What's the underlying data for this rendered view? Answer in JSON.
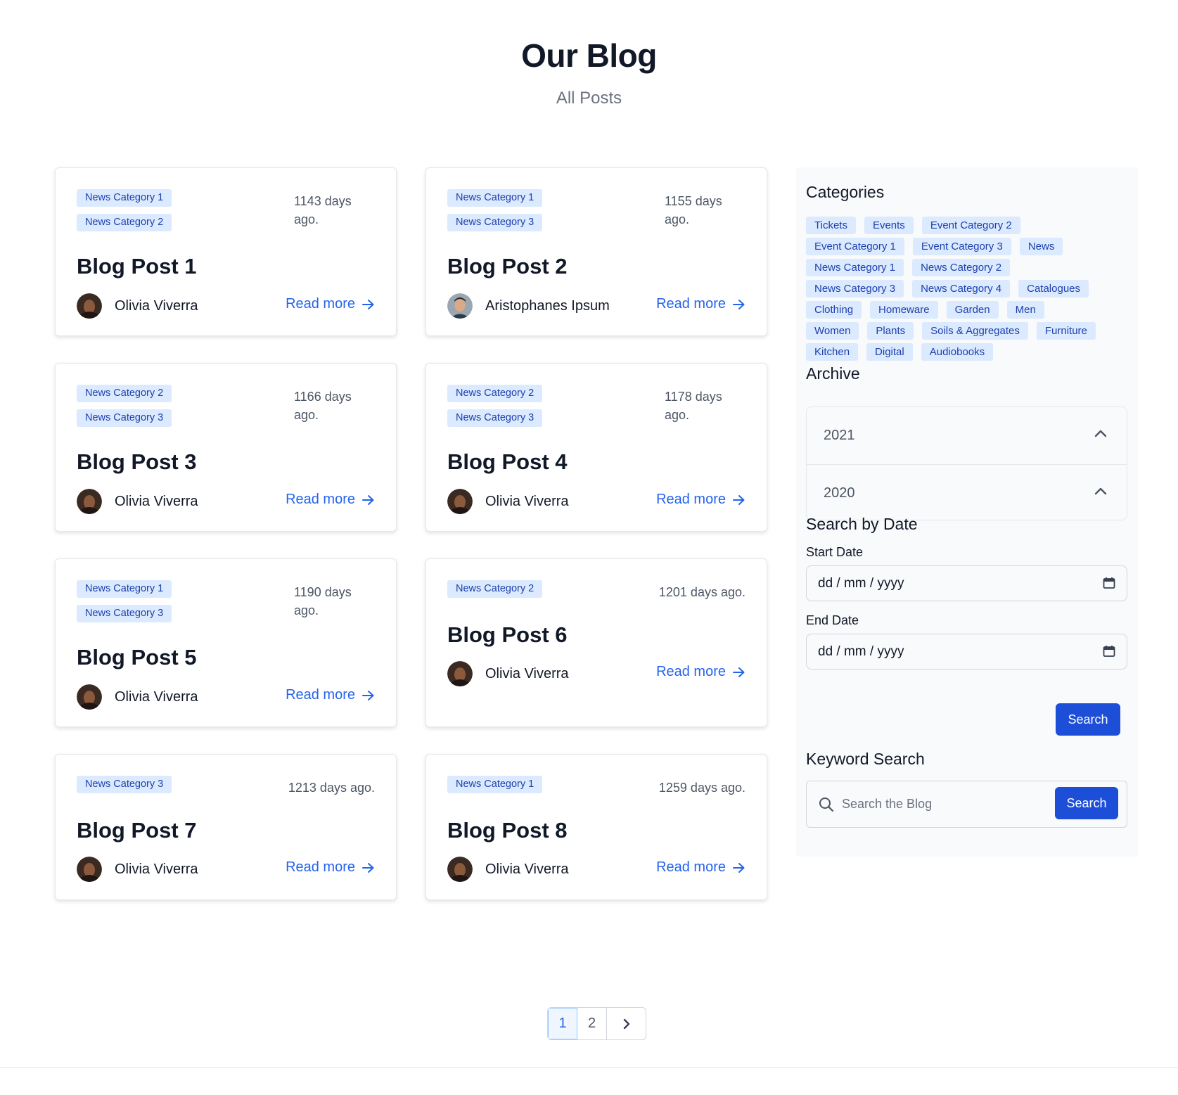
{
  "header": {
    "title": "Our Blog",
    "subtitle": "All Posts"
  },
  "posts": [
    {
      "tags": [
        "News Category 1",
        "News Category 2"
      ],
      "date": "1143 days ago.",
      "title": "Blog Post 1",
      "author": "Olivia Viverra",
      "avatar": "woman",
      "read_more": "Read more"
    },
    {
      "tags": [
        "News Category 1",
        "News Category 3"
      ],
      "date": "1155 days ago.",
      "title": "Blog Post 2",
      "author": "Aristophanes Ipsum",
      "avatar": "man",
      "read_more": "Read more"
    },
    {
      "tags": [
        "News Category 2",
        "News Category 3"
      ],
      "date": "1166 days ago.",
      "title": "Blog Post 3",
      "author": "Olivia Viverra",
      "avatar": "woman",
      "read_more": "Read more"
    },
    {
      "tags": [
        "News Category 2",
        "News Category 3"
      ],
      "date": "1178 days ago.",
      "title": "Blog Post 4",
      "author": "Olivia Viverra",
      "avatar": "woman",
      "read_more": "Read more"
    },
    {
      "tags": [
        "News Category 1",
        "News Category 3"
      ],
      "date": "1190 days ago.",
      "title": "Blog Post 5",
      "author": "Olivia Viverra",
      "avatar": "woman",
      "read_more": "Read more"
    },
    {
      "tags": [
        "News Category 2"
      ],
      "date": "1201 days ago.",
      "title": "Blog Post 6",
      "author": "Olivia Viverra",
      "avatar": "woman",
      "read_more": "Read more"
    },
    {
      "tags": [
        "News Category 3"
      ],
      "date": "1213 days ago.",
      "title": "Blog Post 7",
      "author": "Olivia Viverra",
      "avatar": "woman",
      "read_more": "Read more"
    },
    {
      "tags": [
        "News Category 1"
      ],
      "date": "1259 days ago.",
      "title": "Blog Post 8",
      "author": "Olivia Viverra",
      "avatar": "woman",
      "read_more": "Read more"
    }
  ],
  "sidebar": {
    "categories_heading": "Categories",
    "categories": [
      [
        "Tickets",
        "Events",
        "Event Category 2"
      ],
      [
        "Event Category 1",
        "Event Category 3",
        "News"
      ],
      [
        "News Category 1",
        "News Category 2"
      ],
      [
        "News Category 3",
        "News Category 4",
        "Catalogues"
      ],
      [
        "Clothing",
        "Homeware",
        "Garden",
        "Men"
      ],
      [
        "Women",
        "Plants",
        "Soils & Aggregates",
        "Furniture"
      ],
      [
        "Kitchen",
        "Digital",
        "Audiobooks"
      ]
    ],
    "archive_heading": "Archive",
    "archive_years": [
      "2021",
      "2020"
    ],
    "date_search": {
      "heading": "Search by Date",
      "start_label": "Start Date",
      "start_placeholder": "dd / mm / yyyy",
      "end_label": "End Date",
      "end_placeholder": "dd / mm / yyyy",
      "button": "Search"
    },
    "keyword_search": {
      "heading": "Keyword Search",
      "placeholder": "Search the Blog",
      "button": "Search"
    }
  },
  "pagination": {
    "pages": [
      "1",
      "2"
    ],
    "current": "1"
  },
  "colors": {
    "accent": "#2563eb",
    "button": "#1d4ed8",
    "tag_bg": "#dbeafe",
    "tag_text": "#1e40af"
  },
  "icons": {
    "read_more": "arrow-right-icon",
    "archive_toggle": "chevron-up-icon",
    "date_picker": "calendar-icon",
    "search": "search-icon",
    "next_page": "chevron-right-icon"
  }
}
